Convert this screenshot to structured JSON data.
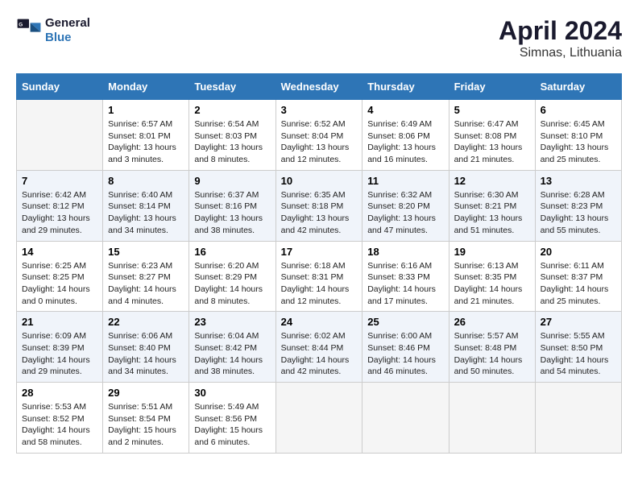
{
  "header": {
    "logo_line1": "General",
    "logo_line2": "Blue",
    "title": "April 2024",
    "subtitle": "Simnas, Lithuania"
  },
  "days_of_week": [
    "Sunday",
    "Monday",
    "Tuesday",
    "Wednesday",
    "Thursday",
    "Friday",
    "Saturday"
  ],
  "weeks": [
    [
      {
        "day": "",
        "info": ""
      },
      {
        "day": "1",
        "info": "Sunrise: 6:57 AM\nSunset: 8:01 PM\nDaylight: 13 hours\nand 3 minutes."
      },
      {
        "day": "2",
        "info": "Sunrise: 6:54 AM\nSunset: 8:03 PM\nDaylight: 13 hours\nand 8 minutes."
      },
      {
        "day": "3",
        "info": "Sunrise: 6:52 AM\nSunset: 8:04 PM\nDaylight: 13 hours\nand 12 minutes."
      },
      {
        "day": "4",
        "info": "Sunrise: 6:49 AM\nSunset: 8:06 PM\nDaylight: 13 hours\nand 16 minutes."
      },
      {
        "day": "5",
        "info": "Sunrise: 6:47 AM\nSunset: 8:08 PM\nDaylight: 13 hours\nand 21 minutes."
      },
      {
        "day": "6",
        "info": "Sunrise: 6:45 AM\nSunset: 8:10 PM\nDaylight: 13 hours\nand 25 minutes."
      }
    ],
    [
      {
        "day": "7",
        "info": "Sunrise: 6:42 AM\nSunset: 8:12 PM\nDaylight: 13 hours\nand 29 minutes."
      },
      {
        "day": "8",
        "info": "Sunrise: 6:40 AM\nSunset: 8:14 PM\nDaylight: 13 hours\nand 34 minutes."
      },
      {
        "day": "9",
        "info": "Sunrise: 6:37 AM\nSunset: 8:16 PM\nDaylight: 13 hours\nand 38 minutes."
      },
      {
        "day": "10",
        "info": "Sunrise: 6:35 AM\nSunset: 8:18 PM\nDaylight: 13 hours\nand 42 minutes."
      },
      {
        "day": "11",
        "info": "Sunrise: 6:32 AM\nSunset: 8:20 PM\nDaylight: 13 hours\nand 47 minutes."
      },
      {
        "day": "12",
        "info": "Sunrise: 6:30 AM\nSunset: 8:21 PM\nDaylight: 13 hours\nand 51 minutes."
      },
      {
        "day": "13",
        "info": "Sunrise: 6:28 AM\nSunset: 8:23 PM\nDaylight: 13 hours\nand 55 minutes."
      }
    ],
    [
      {
        "day": "14",
        "info": "Sunrise: 6:25 AM\nSunset: 8:25 PM\nDaylight: 14 hours\nand 0 minutes."
      },
      {
        "day": "15",
        "info": "Sunrise: 6:23 AM\nSunset: 8:27 PM\nDaylight: 14 hours\nand 4 minutes."
      },
      {
        "day": "16",
        "info": "Sunrise: 6:20 AM\nSunset: 8:29 PM\nDaylight: 14 hours\nand 8 minutes."
      },
      {
        "day": "17",
        "info": "Sunrise: 6:18 AM\nSunset: 8:31 PM\nDaylight: 14 hours\nand 12 minutes."
      },
      {
        "day": "18",
        "info": "Sunrise: 6:16 AM\nSunset: 8:33 PM\nDaylight: 14 hours\nand 17 minutes."
      },
      {
        "day": "19",
        "info": "Sunrise: 6:13 AM\nSunset: 8:35 PM\nDaylight: 14 hours\nand 21 minutes."
      },
      {
        "day": "20",
        "info": "Sunrise: 6:11 AM\nSunset: 8:37 PM\nDaylight: 14 hours\nand 25 minutes."
      }
    ],
    [
      {
        "day": "21",
        "info": "Sunrise: 6:09 AM\nSunset: 8:39 PM\nDaylight: 14 hours\nand 29 minutes."
      },
      {
        "day": "22",
        "info": "Sunrise: 6:06 AM\nSunset: 8:40 PM\nDaylight: 14 hours\nand 34 minutes."
      },
      {
        "day": "23",
        "info": "Sunrise: 6:04 AM\nSunset: 8:42 PM\nDaylight: 14 hours\nand 38 minutes."
      },
      {
        "day": "24",
        "info": "Sunrise: 6:02 AM\nSunset: 8:44 PM\nDaylight: 14 hours\nand 42 minutes."
      },
      {
        "day": "25",
        "info": "Sunrise: 6:00 AM\nSunset: 8:46 PM\nDaylight: 14 hours\nand 46 minutes."
      },
      {
        "day": "26",
        "info": "Sunrise: 5:57 AM\nSunset: 8:48 PM\nDaylight: 14 hours\nand 50 minutes."
      },
      {
        "day": "27",
        "info": "Sunrise: 5:55 AM\nSunset: 8:50 PM\nDaylight: 14 hours\nand 54 minutes."
      }
    ],
    [
      {
        "day": "28",
        "info": "Sunrise: 5:53 AM\nSunset: 8:52 PM\nDaylight: 14 hours\nand 58 minutes."
      },
      {
        "day": "29",
        "info": "Sunrise: 5:51 AM\nSunset: 8:54 PM\nDaylight: 15 hours\nand 2 minutes."
      },
      {
        "day": "30",
        "info": "Sunrise: 5:49 AM\nSunset: 8:56 PM\nDaylight: 15 hours\nand 6 minutes."
      },
      {
        "day": "",
        "info": ""
      },
      {
        "day": "",
        "info": ""
      },
      {
        "day": "",
        "info": ""
      },
      {
        "day": "",
        "info": ""
      }
    ]
  ]
}
